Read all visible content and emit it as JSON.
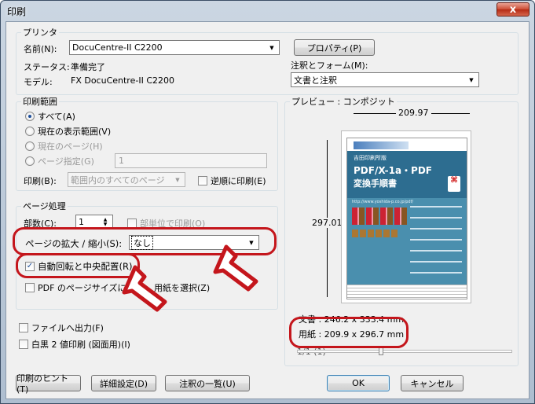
{
  "window": {
    "title": "印刷",
    "close": "x"
  },
  "printer": {
    "group": "プリンタ",
    "name_label": "名前(N):",
    "name_value": "DocuCentre-II C2200",
    "properties": "プロパティ(P)",
    "status_label": "ステータス:",
    "status_value": "準備完了",
    "model_label": "モデル:",
    "model_value": "FX DocuCentre-II C2200",
    "notes_label": "注釈とフォーム(M):",
    "notes_value": "文書と注釈"
  },
  "range": {
    "group": "印刷範囲",
    "all": "すべて(A)",
    "current_view": "現在の表示範囲(V)",
    "current_page": "現在のページ(H)",
    "pages": "ページ指定(G)",
    "pages_value": "1",
    "subset_label": "印刷(B):",
    "subset_value": "範囲内のすべてのページ",
    "reverse": "逆順に印刷(E)"
  },
  "handling": {
    "group": "ページ処理",
    "copies_label": "部数(C):",
    "copies_value": "1",
    "collate": "部単位で印刷(O)",
    "scaling_label": "ページの拡大 / 縮小(S):",
    "scaling_value": "なし",
    "autorotate": "自動回転と中央配置(R)",
    "pdf_size_a": "PDF のページサイズに",
    "pdf_size_b": "用紙を選択(Z)"
  },
  "output": {
    "file": "ファイルへ出力(F)",
    "bw": "白黒 2 値印刷 (図面用)(I)"
  },
  "preview": {
    "group": "プレビュー : コンポジット",
    "width": "209.97",
    "height": "297.01",
    "doc": "文書 : 246.2 x 333.4 mm",
    "paper": "用紙 : 209.9 x 296.7 mm",
    "page": "1/1 (1)"
  },
  "thumb": {
    "publisher": "吉田印刷所版",
    "title1": "PDF/X-1a・PDF",
    "title2": "変換手順書",
    "url": "http://www.yoshida-p.co.jp/pdf/"
  },
  "buttons": {
    "tips": "印刷のヒント(T)",
    "advanced": "詳細設定(D)",
    "summarize": "注釈の一覧(U)",
    "ok": "OK",
    "cancel": "キャンセル"
  }
}
